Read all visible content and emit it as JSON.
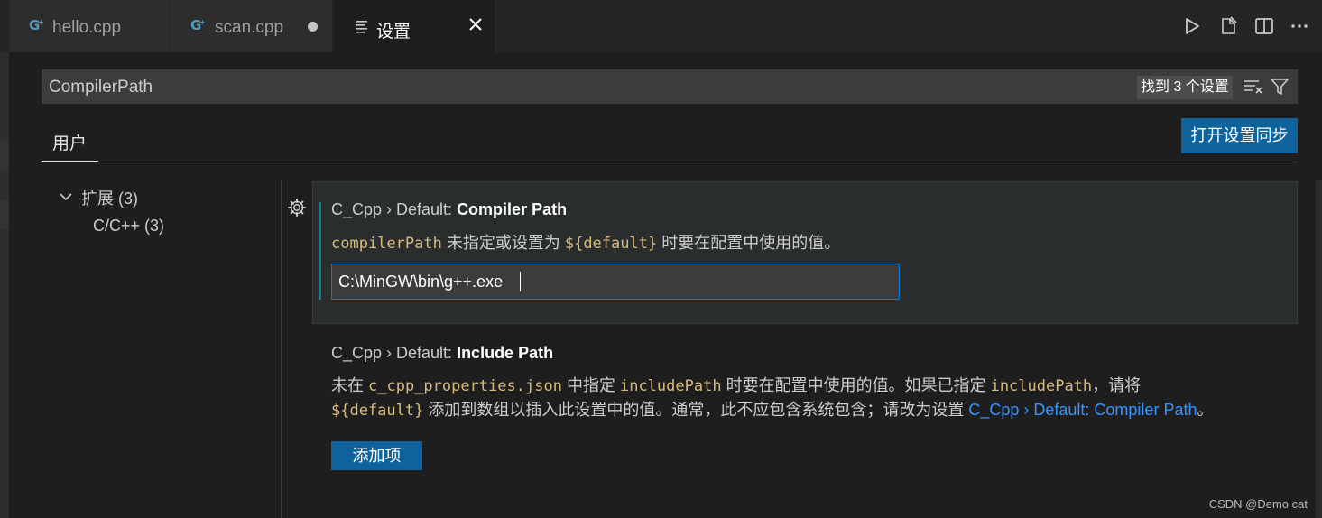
{
  "tabs": [
    {
      "label": "hello.cpp",
      "icon": "cpp-file-icon",
      "active": false
    },
    {
      "label": "scan.cpp",
      "icon": "cpp-file-icon",
      "active": false,
      "dirty": true
    },
    {
      "label": "设置",
      "icon": "settings-file-icon",
      "active": true
    }
  ],
  "toolbar": [
    "run-icon",
    "open-settings-json-icon",
    "split-editor-icon",
    "more-actions-icon"
  ],
  "search": {
    "value": "CompilerPath",
    "result_count": "找到 3 个设置"
  },
  "scope": {
    "user_tab": "用户",
    "sync_button": "打开设置同步"
  },
  "toc": {
    "extensions": "扩展 (3)",
    "cpp": "C/C++ (3)"
  },
  "settings": [
    {
      "prefix": "C_Cpp › Default: ",
      "name": "Compiler Path",
      "desc_code1": "compilerPath",
      "desc_text1": " 未指定或设置为 ",
      "desc_code2": "${default}",
      "desc_text2": " 时要在配置中使用的值。",
      "value": "C:\\MinGW\\bin\\g++.exe"
    },
    {
      "prefix": "C_Cpp › Default: ",
      "name": "Include Path",
      "l1_text1": "未在 ",
      "l1_code1": "c_cpp_properties.json",
      "l1_text2": " 中指定 ",
      "l1_code2": "includePath",
      "l1_text3": " 时要在配置中使用的值。如果已指定 ",
      "l1_code3": "includePath",
      "l1_text4": "，请将",
      "l2_code1": "${default}",
      "l2_text1": " 添加到数组以插入此设置中的值。通常，此不应包含系统包含；请改为设置 ",
      "l2_link": "C_Cpp › Default: Compiler Path",
      "l2_text2": "。",
      "add_button": "添加项"
    }
  ],
  "watermark": "CSDN @Demo cat",
  "colors": {
    "accent": "#0e639c",
    "focus": "#007fd4",
    "code": "#d7ba7d",
    "link": "#3794ff"
  }
}
